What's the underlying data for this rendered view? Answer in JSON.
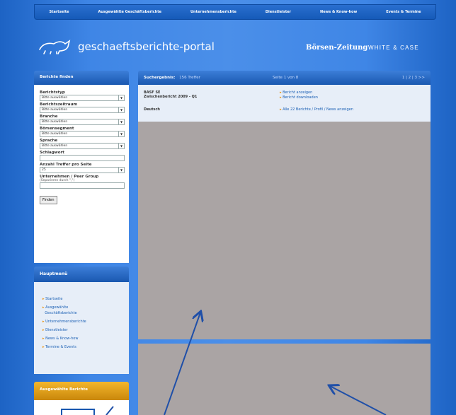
{
  "topnav": {
    "items": [
      "Startseite",
      "Ausgewählte Geschäftsberichte",
      "Unternehmensberichte",
      "Dienstleister",
      "News & Know-how",
      "Events & Termine"
    ]
  },
  "header": {
    "logo_text": "geschaeftsberichte-portal",
    "partner1": "Börsen-Zeitung",
    "partner2": "WHITE & CASE"
  },
  "search": {
    "title": "Berichte finden",
    "fields": [
      {
        "label": "Berichtstyp",
        "value": "Bitte auswählen"
      },
      {
        "label": "Berichtszeitraum",
        "value": "Bitte auswählen"
      },
      {
        "label": "Branche",
        "value": "Bitte auswählen"
      },
      {
        "label": "Börsensegment",
        "value": "Bitte auswählen"
      },
      {
        "label": "Sprache",
        "value": "Bitte auswählen"
      }
    ],
    "keyword_label": "Schlagwort",
    "per_page_label": "Anzahl Treffer pro Seite",
    "per_page_value": "25",
    "company_label": "Unternehmen / Peer Group",
    "company_sub": "(Separieren durch \",\")",
    "find_button": "Finden"
  },
  "mainmenu": {
    "title": "Hauptmenü",
    "items": [
      "Startseite",
      "Ausgewählte",
      "Geschäftsberichte",
      "Unternehmensberichte",
      "Dienstleister",
      "News & Know-how",
      "Termine & Events"
    ]
  },
  "featured": {
    "title": "Ausgewählte Berichte"
  },
  "results": {
    "label": "Suchergebnis:",
    "count": "156 Treffer",
    "page_info": "Seite 1 von 8",
    "pagination": "1 | 2 | 3  >>",
    "company": "BASF SE",
    "report": "Zwischenbericht 2009 - Q1",
    "language": "Deutsch",
    "link_view": "Bericht anzeigen",
    "link_download": "Bericht downloaden",
    "link_all": "Alle 22 Berichte / Profil / News anzeigen"
  },
  "colors": {
    "background": "#3f86e6",
    "nav": "#155ab8",
    "accent": "#e88d00",
    "placeholder_gray": "#aaa4a4",
    "arrow": "#1f4fa8"
  }
}
